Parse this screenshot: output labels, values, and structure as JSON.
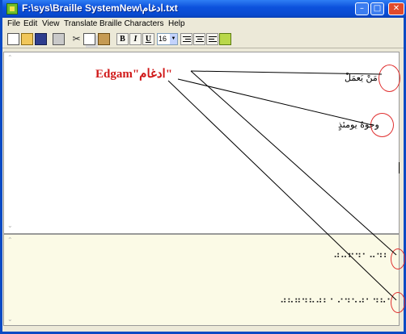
{
  "window": {
    "title": "F:\\sys\\Braille SystemNew\\ادغام.txt",
    "buttons": {
      "minimize": "–",
      "maximize": "□",
      "close": "✕"
    }
  },
  "menu": [
    "File",
    "Edit",
    "View",
    "Translate",
    "Braille Characters",
    "Help"
  ],
  "toolbar": {
    "icons": [
      "new-icon",
      "open-icon",
      "save-icon",
      "print-icon",
      "cut-icon",
      "copy-icon",
      "paste-icon"
    ],
    "bold": "B",
    "italic": "I",
    "underline": "U",
    "font_size": "16",
    "align": [
      "align-right-icon",
      "align-center-icon",
      "align-left-icon"
    ],
    "braille_icon": "braille-icon"
  },
  "editor": {
    "lines": [
      "مَنْ يَعمَلْ",
      "وجوهٌ يومئذٍ"
    ]
  },
  "braille": {
    "lines": [
      "⠚⠒⠋⠙⠁⠒⠙⠃",
      "⠚⠓⠛⠙⠓⠚⠃⠁⠊⠙⠑⠚⠁⠙⠓⠁"
    ]
  },
  "annotation": {
    "text": "Edgam\"ادغام\"",
    "color": "#d01818"
  },
  "colors": {
    "titlebar": "#0d52dd",
    "chrome": "#ece9d8",
    "braille_pane": "#fbfae6",
    "annotation": "#d01818"
  }
}
